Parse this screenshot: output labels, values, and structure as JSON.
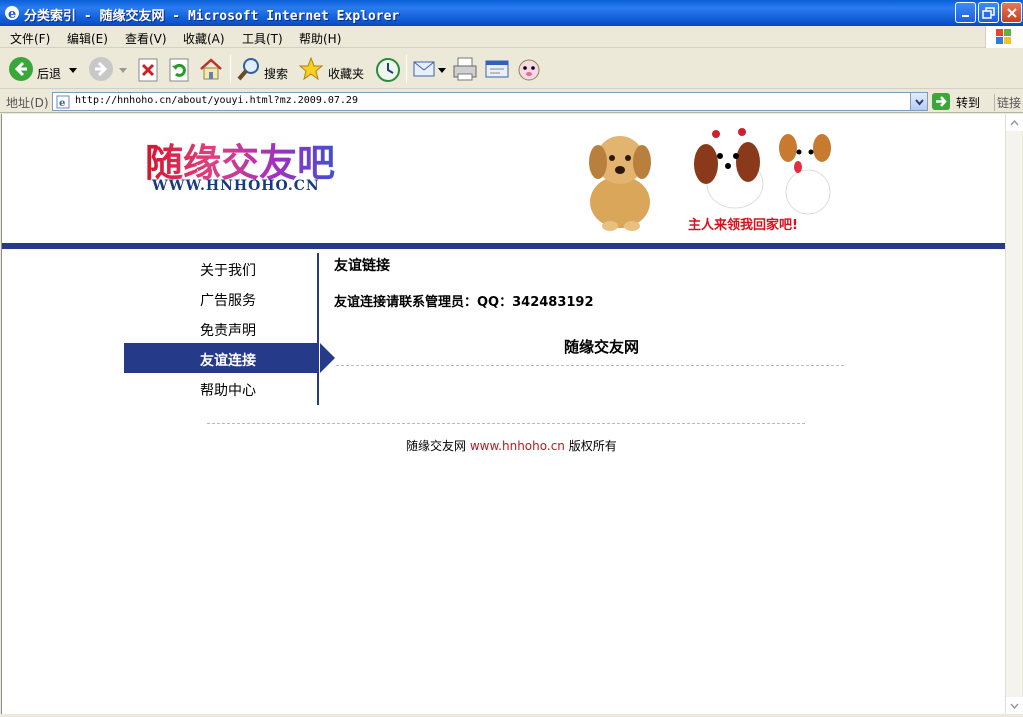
{
  "window": {
    "title": "分类索引 - 随缘交友网 - Microsoft Internet Explorer"
  },
  "menu": {
    "items": [
      "文件(F)",
      "编辑(E)",
      "查看(V)",
      "收藏(A)",
      "工具(T)",
      "帮助(H)"
    ]
  },
  "toolbar": {
    "back_label": "后退",
    "search_label": "搜索",
    "favorites_label": "收藏夹"
  },
  "address": {
    "label": "地址(D)",
    "url": "http://hnhoho.cn/about/youyi.html?mz.2009.07.29",
    "go_label": "转到",
    "links_label": "链接"
  },
  "page": {
    "logo_text": "随缘交友吧",
    "logo_url": "WWW.HNHOHO.CN",
    "banner_caption": "主人来领我回家吧!",
    "nav": [
      {
        "label": "关于我们",
        "active": false
      },
      {
        "label": "广告服务",
        "active": false
      },
      {
        "label": "免责声明",
        "active": false
      },
      {
        "label": "友谊连接",
        "active": true
      },
      {
        "label": "帮助中心",
        "active": false
      }
    ],
    "heading": "友谊链接",
    "contact": "友谊连接请联系管理员：QQ：342483192",
    "site_name": "随缘交友网",
    "footer_prefix": "随缘交友网 ",
    "footer_link": "www.hnhoho.cn",
    "footer_suffix": " 版权所有",
    "accent_color": "#263a8a",
    "link_color": "#c0171f"
  }
}
